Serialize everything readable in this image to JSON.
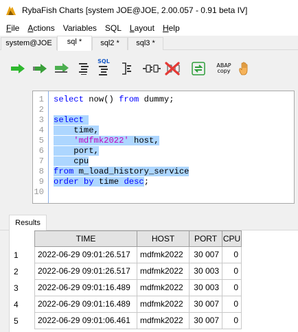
{
  "window": {
    "title": "RybaFish Charts [system JOE@JOE, 2.00.057 - 0.91 beta IV]"
  },
  "menu": {
    "items": [
      {
        "label": "File",
        "accel": "F",
        "rest": "ile"
      },
      {
        "label": "Actions",
        "accel": "A",
        "rest": "ctions"
      },
      {
        "label": "Variables",
        "accel": "",
        "rest": "Variables"
      },
      {
        "label": "SQL",
        "accel": "",
        "rest": "SQL"
      },
      {
        "label": "Layout",
        "accel": "L",
        "rest": "ayout"
      },
      {
        "label": "Help",
        "accel": "H",
        "rest": "elp"
      }
    ]
  },
  "tabs": [
    {
      "label": "system@JOE",
      "active": false
    },
    {
      "label": "sql *",
      "active": true
    },
    {
      "label": "sql2 *",
      "active": false
    },
    {
      "label": "sql3 *",
      "active": false
    }
  ],
  "toolbar": {
    "buttons": [
      {
        "icon": "execute-arrow-icon"
      },
      {
        "icon": "execute-all-arrow-icon"
      },
      {
        "icon": "execute-selection-arrow-icon"
      },
      {
        "icon": "format-sql-icon"
      },
      {
        "icon": "sql-explain-icon",
        "label": "SQL"
      },
      {
        "icon": "bracket-icon"
      },
      {
        "icon": "connect-plug-icon"
      },
      {
        "icon": "disconnect-icon"
      },
      {
        "icon": "refresh-icon"
      },
      {
        "icon": "abap-copy-icon",
        "label_line1": "ABAP",
        "label_line2": "copy"
      },
      {
        "icon": "hand-icon"
      }
    ]
  },
  "editor": {
    "lines": [
      {
        "n": "1",
        "tokens": [
          {
            "t": "select",
            "c": "kw"
          },
          {
            "t": " now() "
          },
          {
            "t": "from",
            "c": "kw"
          },
          {
            "t": " dummy;"
          }
        ]
      },
      {
        "n": "2",
        "tokens": []
      },
      {
        "n": "3",
        "tokens": [
          {
            "t": "select ",
            "c": "kw",
            "sel": true
          }
        ]
      },
      {
        "n": "4",
        "tokens": [
          {
            "t": "    time,",
            "sel": true
          }
        ]
      },
      {
        "n": "5",
        "tokens": [
          {
            "t": "    ",
            "sel": true
          },
          {
            "t": "'mdfmk2022'",
            "c": "str",
            "sel": true
          },
          {
            "t": " host,",
            "sel": true
          }
        ]
      },
      {
        "n": "6",
        "tokens": [
          {
            "t": "    port,",
            "sel": true
          }
        ]
      },
      {
        "n": "7",
        "tokens": [
          {
            "t": "    cpu",
            "sel": true
          }
        ]
      },
      {
        "n": "8",
        "tokens": [
          {
            "t": "from",
            "c": "kw",
            "sel": true
          },
          {
            "t": " m_load_history_service",
            "sel": true
          }
        ]
      },
      {
        "n": "9",
        "tokens": [
          {
            "t": "order",
            "c": "kw",
            "sel": true
          },
          {
            "t": " ",
            "sel": true
          },
          {
            "t": "by",
            "c": "kw",
            "sel": true
          },
          {
            "t": " time ",
            "sel": true
          },
          {
            "t": "desc",
            "c": "kw",
            "sel": true
          },
          {
            "t": ";"
          }
        ]
      },
      {
        "n": "10",
        "tokens": []
      }
    ]
  },
  "results": {
    "tab_label": "Results",
    "columns": [
      "TIME",
      "HOST",
      "PORT",
      "CPU"
    ],
    "rows": [
      {
        "n": "1",
        "cells": [
          "2022-06-29 09:01:26.517",
          "mdfmk2022",
          "30 007",
          "0"
        ]
      },
      {
        "n": "2",
        "cells": [
          "2022-06-29 09:01:26.517",
          "mdfmk2022",
          "30 003",
          "0"
        ]
      },
      {
        "n": "3",
        "cells": [
          "2022-06-29 09:01:16.489",
          "mdfmk2022",
          "30 003",
          "0"
        ]
      },
      {
        "n": "4",
        "cells": [
          "2022-06-29 09:01:16.489",
          "mdfmk2022",
          "30 007",
          "0"
        ]
      },
      {
        "n": "5",
        "cells": [
          "2022-06-29 09:01:06.461",
          "mdfmk2022",
          "30 007",
          "0"
        ]
      }
    ]
  }
}
